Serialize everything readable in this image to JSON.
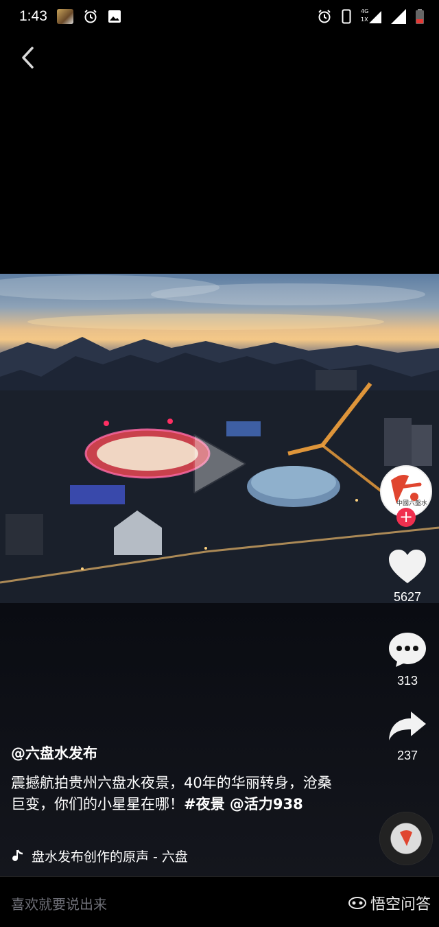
{
  "status_bar": {
    "time": "1:43",
    "network_top": "4G",
    "network_bottom": "1X"
  },
  "video": {
    "state": "paused"
  },
  "creator": {
    "avatar_text": "中國六盤水"
  },
  "actions": {
    "likes": "5627",
    "comments": "313",
    "shares": "237"
  },
  "post": {
    "author": "@六盘水发布",
    "caption_text": "震撼航拍贵州六盘水夜景，40年的华丽转身，沧桑巨变，你们的小星星在哪！",
    "caption_tags": "#夜景 @活力938",
    "music": "盘水发布创作的原声 - 六盘"
  },
  "comment": {
    "placeholder": "喜欢就要说出来"
  },
  "watermark": {
    "text": "悟空问答"
  },
  "colors": {
    "follow": "#f0304f",
    "background": "#000000"
  }
}
